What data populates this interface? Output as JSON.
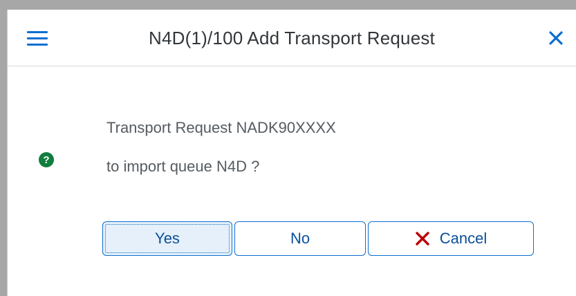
{
  "dialog": {
    "title": "N4D(1)/100 Add Transport Request",
    "message_line1": "Transport Request NADK90XXXX",
    "message_line2": "to import queue N4D ?",
    "icon": "question-icon"
  },
  "buttons": {
    "yes": "Yes",
    "no": "No",
    "cancel": "Cancel"
  },
  "colors": {
    "accent": "#0a6ed1",
    "question_icon": "#107e3e",
    "cancel_icon": "#bb0000"
  }
}
